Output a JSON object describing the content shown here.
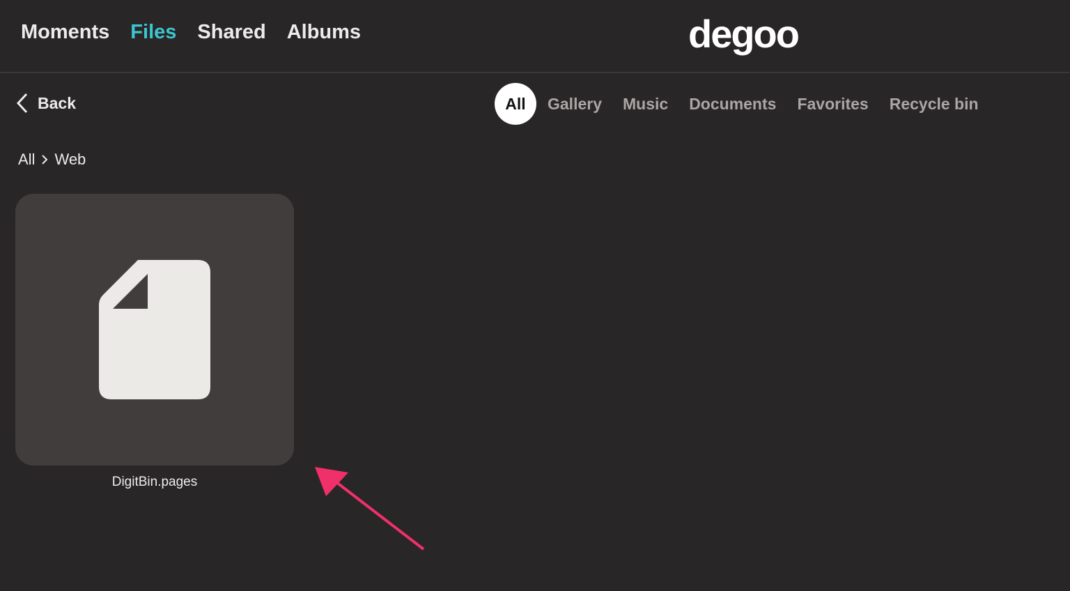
{
  "nav": {
    "items": [
      {
        "label": "Moments"
      },
      {
        "label": "Files",
        "active": true
      },
      {
        "label": "Shared"
      },
      {
        "label": "Albums"
      }
    ]
  },
  "logo": "degoo",
  "back_label": "Back",
  "filters": [
    "All",
    "Gallery",
    "Music",
    "Documents",
    "Favorites",
    "Recycle bin"
  ],
  "breadcrumb": [
    "All",
    "Web"
  ],
  "files": [
    {
      "name": "DigitBin.pages",
      "icon": "document-icon"
    }
  ],
  "colors": {
    "accent": "#3cc6cf",
    "arrow": "#f0306a"
  }
}
